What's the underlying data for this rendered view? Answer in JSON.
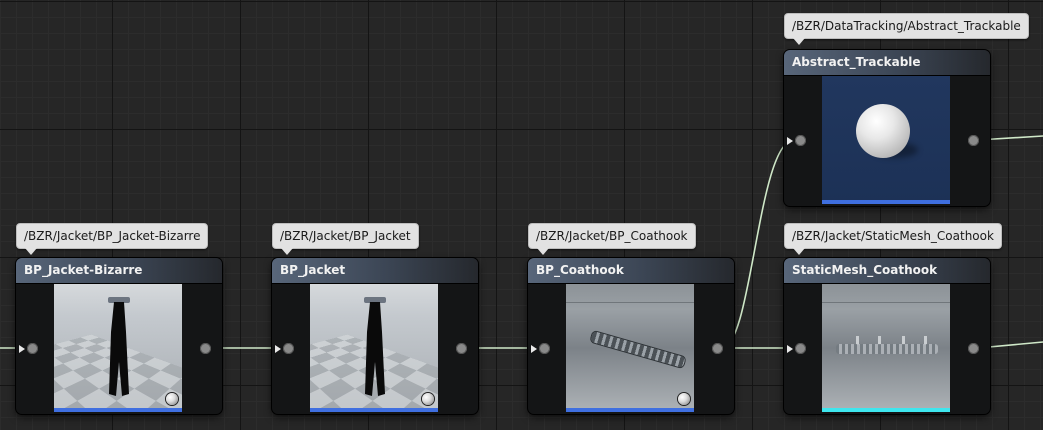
{
  "nodes": [
    {
      "id": "bp_jacket_bizarre",
      "title": "BP_Jacket-Bizarre",
      "path": "/BZR/Jacket/BP_Jacket-Bizarre",
      "thumbnail": "jacket",
      "accent": "#3f6fe0"
    },
    {
      "id": "bp_jacket",
      "title": "BP_Jacket",
      "path": "/BZR/Jacket/BP_Jacket",
      "thumbnail": "jacket",
      "accent": "#3f6fe0"
    },
    {
      "id": "bp_coathook",
      "title": "BP_Coathook",
      "path": "/BZR/Jacket/BP_Coathook",
      "thumbnail": "coathook",
      "accent": "#3f6fe0"
    },
    {
      "id": "abstract_trackable",
      "title": "Abstract_Trackable",
      "path": "/BZR/DataTracking/Abstract_Trackable",
      "thumbnail": "sphere",
      "accent": "#3f6fe0"
    },
    {
      "id": "staticmesh_coathook",
      "title": "StaticMesh_Coathook",
      "path": "/BZR/Jacket/StaticMesh_Coathook",
      "thumbnail": "static-mesh",
      "accent": "#3ee6ee"
    }
  ],
  "colors": {
    "wire": "#cfe8c8",
    "grid_major": "#141414",
    "grid_minor": "#2c2c2c",
    "canvas": "#262626"
  }
}
